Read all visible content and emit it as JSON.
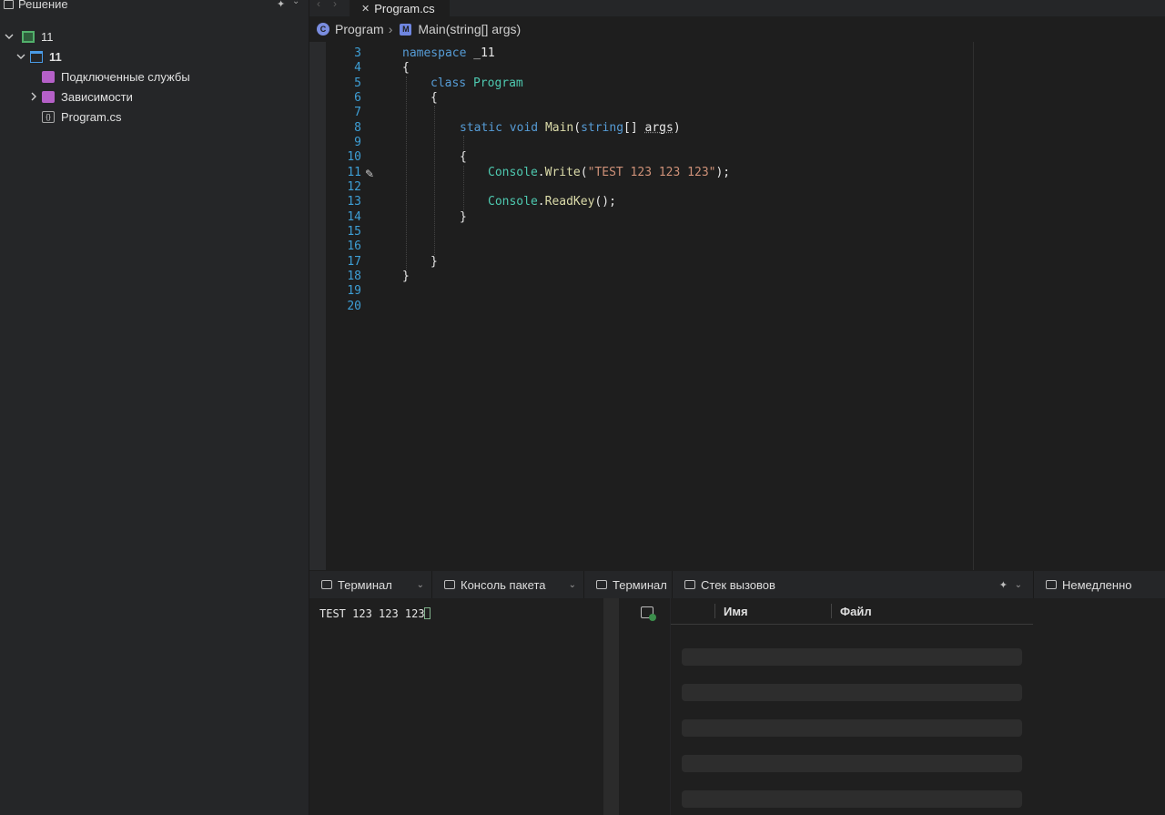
{
  "sidebar": {
    "title": "Решение",
    "items": [
      {
        "label": "11",
        "icon": "solution-icon"
      },
      {
        "label": "11",
        "icon": "project-icon"
      },
      {
        "label": "Подключенные службы",
        "icon": "connected-services-icon"
      },
      {
        "label": "Зависимости",
        "icon": "dependencies-folder-icon"
      },
      {
        "label": "Program.cs",
        "icon": "csharp-file-icon"
      }
    ]
  },
  "tabs": [
    {
      "label": "Program.cs",
      "active": true
    }
  ],
  "breadcrumb": {
    "items": [
      "Program",
      "Main(string[] args)"
    ],
    "separator": "›"
  },
  "editor": {
    "line_numbers": [
      "3",
      "4",
      "5",
      "6",
      "7",
      "8",
      "9",
      "10",
      "11",
      "12",
      "13",
      "14",
      "15",
      "16",
      "17",
      "18",
      "19",
      "20"
    ],
    "code": {
      "l3_kw": "namespace",
      "l3_name": " _11",
      "l4": "{",
      "l5_kw": "class",
      "l5_name": "Program",
      "l6": "{",
      "l8_kw1": "static",
      "l8_kw2": "void",
      "l8_fn": "Main",
      "l8_p1": "(",
      "l8_kw3": "string",
      "l8_p2": "[] ",
      "l8_arg": "args",
      "l8_p3": ")",
      "l10": "{",
      "l11_ty": "Console",
      "l11_dot": ".",
      "l11_fn": "Write",
      "l11_p1": "(",
      "l11_str": "\"TEST 123 123 123\"",
      "l11_p2": ");",
      "l13_ty": "Console",
      "l13_dot": ".",
      "l13_fn": "ReadKey",
      "l13_p": "();",
      "l14": "}",
      "l17": "}",
      "l18": "}"
    }
  },
  "panels": {
    "terminal1": "Терминал",
    "package_console": "Консоль пакета",
    "terminal2": "Терминал",
    "call_stack": "Стек вызовов",
    "immediate": "Немедленно",
    "col_name": "Имя",
    "col_file": "Файл",
    "terminal_output": "TEST 123 123 123"
  },
  "colors": {
    "keyword": "#569cd6",
    "type": "#4ec9b0",
    "function": "#dcdcaa",
    "string": "#ce9178",
    "line_number": "#3e9fd6"
  }
}
